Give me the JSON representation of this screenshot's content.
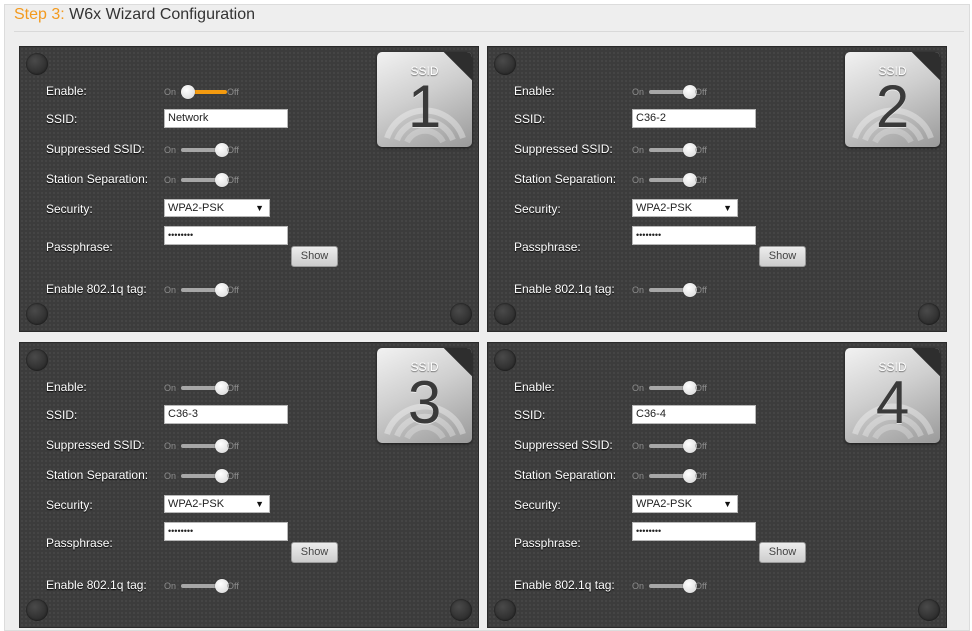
{
  "header": {
    "step": "Step 3:",
    "title": "W6x Wizard Configuration"
  },
  "labels": {
    "enable": "Enable:",
    "ssid": "SSID:",
    "suppressed": "Suppressed SSID:",
    "separation": "Station Separation:",
    "security": "Security:",
    "passphrase": "Passphrase:",
    "tag": "Enable 802.1q tag:",
    "on": "On",
    "off": "Off",
    "show": "Show",
    "badge": "SSID"
  },
  "colors": {
    "accent": "#f39a1e",
    "panel": "#3c3c3c",
    "toggle_on": "#f39a0f"
  },
  "icons": {
    "wifi_waves": "wifi-icon",
    "select_arrow": "triangle-down-icon"
  },
  "panels": [
    {
      "number": "1",
      "enable": "on",
      "ssid": "Network",
      "suppressed": "off",
      "separation": "off",
      "security": "WPA2-PSK",
      "passphrase_mask": "••••••••",
      "tag": "off"
    },
    {
      "number": "2",
      "enable": "off",
      "ssid": "C36-2",
      "suppressed": "off",
      "separation": "off",
      "security": "WPA2-PSK",
      "passphrase_mask": "••••••••",
      "tag": "off"
    },
    {
      "number": "3",
      "enable": "off",
      "ssid": "C36-3",
      "suppressed": "off",
      "separation": "off",
      "security": "WPA2-PSK",
      "passphrase_mask": "••••••••",
      "tag": "off"
    },
    {
      "number": "4",
      "enable": "off",
      "ssid": "C36-4",
      "suppressed": "off",
      "separation": "off",
      "security": "WPA2-PSK",
      "passphrase_mask": "••••••••",
      "tag": "off"
    }
  ]
}
